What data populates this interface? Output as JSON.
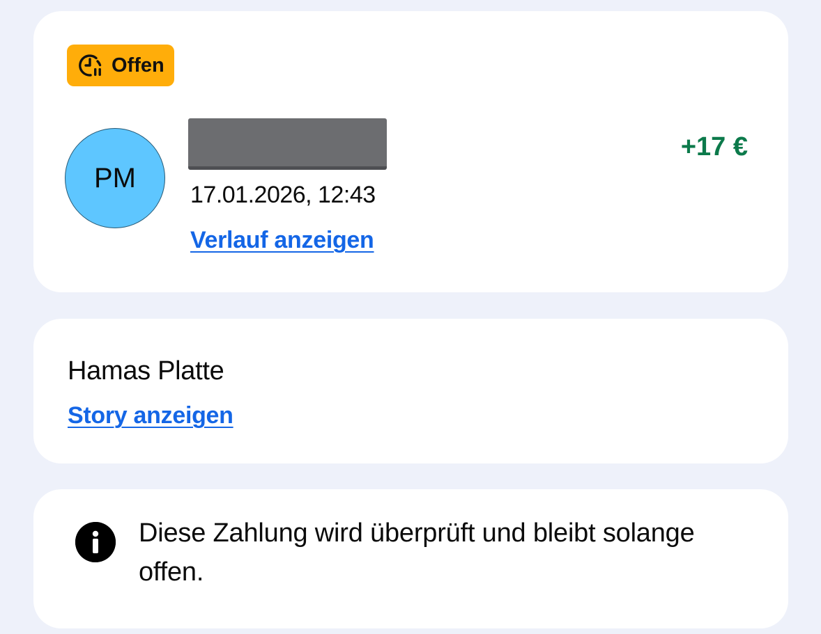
{
  "transaction": {
    "status_label": "Offen",
    "status_icon": "clock-pause-icon",
    "status_color": "#ffad0a",
    "avatar_initials": "PM",
    "avatar_color": "#5ec6ff",
    "timestamp": "17.01.2026, 12:43",
    "history_link": "Verlauf anzeigen",
    "amount": "+17 €",
    "amount_color": "#0c7a4b"
  },
  "note": {
    "title": "Hamas Platte",
    "story_link": "Story anzeigen",
    "link_color": "#1466e6"
  },
  "info": {
    "icon": "info-icon",
    "text": "Diese Zahlung wird überprüft und bleibt solange offen."
  }
}
